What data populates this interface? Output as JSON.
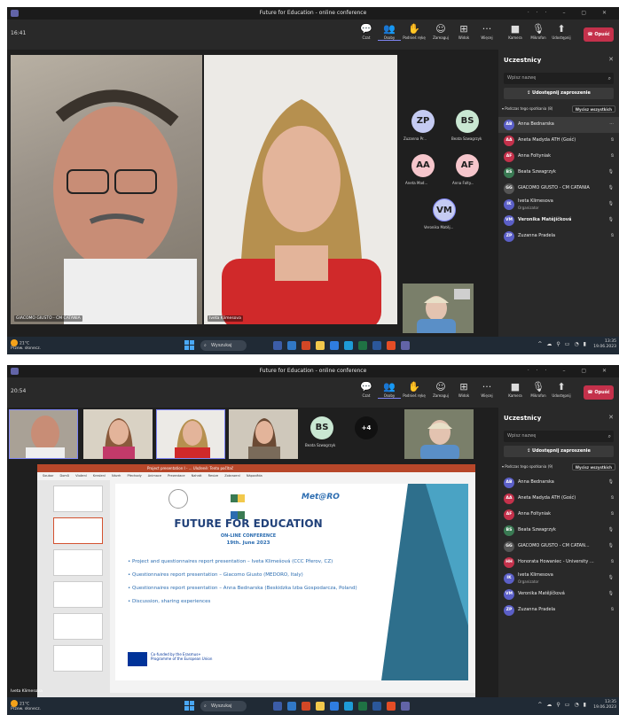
{
  "window_title": "Future for Education - online conference",
  "toolbar": {
    "chat": "Czat",
    "people": "Osoby",
    "raise_hand": "Podnieś rękę",
    "react": "Zareaguj",
    "view": "Widok",
    "more": "Więcej",
    "camera": "Kamera",
    "mic": "Mikrofon",
    "share": "Udostępnij",
    "leave": "Opuść"
  },
  "panel": {
    "title": "Uczestnicy",
    "search_placeholder": "Wpisz nazwę",
    "share_invite": "Udostępnij zaproszenie",
    "mute_all": "Wycisz wszystkich"
  },
  "shot1": {
    "timer": "16:41",
    "section": "Podczas tego spotkania (8)",
    "participants": [
      {
        "initials": "AB",
        "name": "Anna Bednarska",
        "color": "#5b5fc7",
        "extra": "···"
      },
      {
        "initials": "AA",
        "name": "Aneta Madyda ATH (Gość)",
        "color": "#c4314b",
        "extra": ""
      },
      {
        "initials": "AF",
        "name": "Anna Foltyniak",
        "color": "#c4314b",
        "extra": ""
      },
      {
        "initials": "BS",
        "name": "Beata Szwagrzyk",
        "color": "#3a7a53",
        "extra": ""
      },
      {
        "initials": "GG",
        "name": "GIACOMO GIUSTO - CM CATANIA",
        "color": "#555",
        "extra": ""
      },
      {
        "initials": "IK",
        "name": "Iveta Klimesova",
        "role": "Organizator",
        "color": "#5b5fc7",
        "extra": ""
      },
      {
        "initials": "VM",
        "name": "Veronika Matějíčková",
        "color": "#5b5fc7",
        "extra": ""
      },
      {
        "initials": "ZP",
        "name": "Zuzanna Pradela",
        "color": "#5b5fc7",
        "extra": ""
      }
    ],
    "tile_left": "GIACOMO GIUSTO - CM CATANIA",
    "tile_mid": "Iveta Klimesova",
    "avatars": [
      {
        "initials": "ZP",
        "label": "Zuzanna Pr...",
        "color": "#c5cbf2"
      },
      {
        "initials": "BS",
        "label": "Beata Szwagrzyk",
        "color": "#c9e7d2"
      },
      {
        "initials": "AA",
        "label": "Aneta Mad...",
        "color": "#f6c6cc"
      },
      {
        "initials": "AF",
        "label": "Anna Folty...",
        "color": "#f6c6cc"
      },
      {
        "initials": "VM",
        "label": "Veronika Matěj...",
        "color": "#c5cbf2"
      }
    ]
  },
  "shot2": {
    "timer": "20:54",
    "section": "Podczas tego spotkania (9)",
    "participants": [
      {
        "initials": "AB",
        "name": "Anna Bednarska",
        "color": "#5b5fc7"
      },
      {
        "initials": "AA",
        "name": "Aneta Madyda ATH (Gość)",
        "color": "#c4314b"
      },
      {
        "initials": "AF",
        "name": "Anna Foltyniak",
        "color": "#c4314b"
      },
      {
        "initials": "BS",
        "name": "Beata Szwagrzyk",
        "color": "#3a7a53"
      },
      {
        "initials": "GG",
        "name": "GIACOMO GIUSTO - CM CATAN...",
        "color": "#555"
      },
      {
        "initials": "HH",
        "name": "Honorata Howaniec - University ...",
        "color": "#c4314b"
      },
      {
        "initials": "IK",
        "name": "Iveta Klimesova",
        "role": "Organizator",
        "color": "#5b5fc7"
      },
      {
        "initials": "VM",
        "name": "Veronika Matějíčková",
        "color": "#5b5fc7"
      },
      {
        "initials": "ZP",
        "name": "Zuzanna Pradela",
        "color": "#5b5fc7"
      }
    ],
    "strip_bs_initials": "BS",
    "strip_bs_label": "Beata Szwagrzyk",
    "strip_more": "+4",
    "presenter_label": "Iveta Klimesova",
    "slide": {
      "title": "FUTURE FOR EDUCATION",
      "subtitle": "ON-LINE CONFERENCE",
      "date": "19th. June 2023",
      "bullets": [
        "Project and questionnaires report presentation – Iveta Klimešová (CCC Přerov, CZ)",
        "Questionnaires report presentation – Giacomo Giusto (MEDORO, Italy)",
        "Questionnaires report presentation – Anna Bednarska (Beskidzka Izba Gospodarcza, Poland)",
        "Discussion, sharing experiences"
      ],
      "eu_text": "Co-funded by the Erasmus+ Programme of the European Union",
      "logo_right": "Met@RO"
    },
    "ribbon_tabs": [
      "Soubor",
      "Domů",
      "Vložení",
      "Kreslení",
      "Návrh",
      "Přechody",
      "Animace",
      "Prezentace",
      "Nahrát",
      "Revize",
      "Zobrazení",
      "Nápověda"
    ],
    "pp_file": "Project presentation I - ... Uložené: Tento počítač"
  },
  "taskbar": {
    "temp": "21°C",
    "weather": "Przew. słonecz.",
    "search": "Wyszukaj",
    "time": "13:35",
    "date": "19.06.2023"
  }
}
